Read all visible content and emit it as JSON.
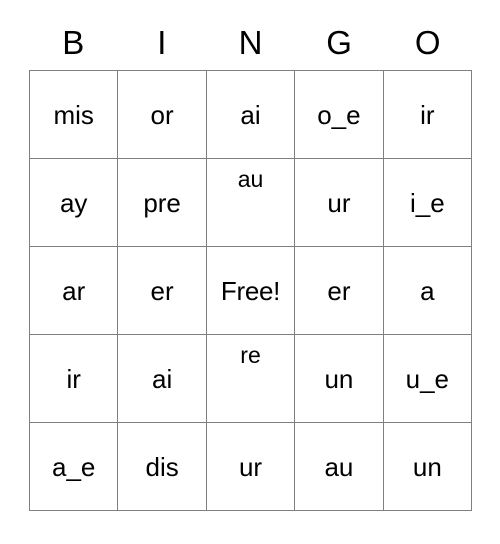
{
  "card": {
    "header": [
      "B",
      "I",
      "N",
      "G",
      "O"
    ],
    "rows": [
      [
        {
          "text": "mis",
          "align": "middle"
        },
        {
          "text": "or",
          "align": "middle"
        },
        {
          "text": "ai",
          "align": "middle"
        },
        {
          "text": "o_e",
          "align": "middle"
        },
        {
          "text": "ir",
          "align": "middle"
        }
      ],
      [
        {
          "text": "ay",
          "align": "middle"
        },
        {
          "text": "pre",
          "align": "middle"
        },
        {
          "text": "au",
          "align": "top"
        },
        {
          "text": "ur",
          "align": "middle"
        },
        {
          "text": "i_e",
          "align": "middle"
        }
      ],
      [
        {
          "text": "ar",
          "align": "middle"
        },
        {
          "text": "er",
          "align": "middle"
        },
        {
          "text": "Free!",
          "align": "middle",
          "free": true
        },
        {
          "text": "er",
          "align": "middle"
        },
        {
          "text": "a",
          "align": "middle"
        }
      ],
      [
        {
          "text": "ir",
          "align": "middle"
        },
        {
          "text": "ai",
          "align": "middle"
        },
        {
          "text": "re",
          "align": "top"
        },
        {
          "text": "un",
          "align": "middle"
        },
        {
          "text": "u_e",
          "align": "middle"
        }
      ],
      [
        {
          "text": "a_e",
          "align": "middle"
        },
        {
          "text": "dis",
          "align": "middle"
        },
        {
          "text": "ur",
          "align": "middle"
        },
        {
          "text": "au",
          "align": "middle"
        },
        {
          "text": "un",
          "align": "middle"
        }
      ]
    ],
    "colors": {
      "background": "#ffffff",
      "text": "#000000",
      "grid_line": "#808080"
    }
  }
}
